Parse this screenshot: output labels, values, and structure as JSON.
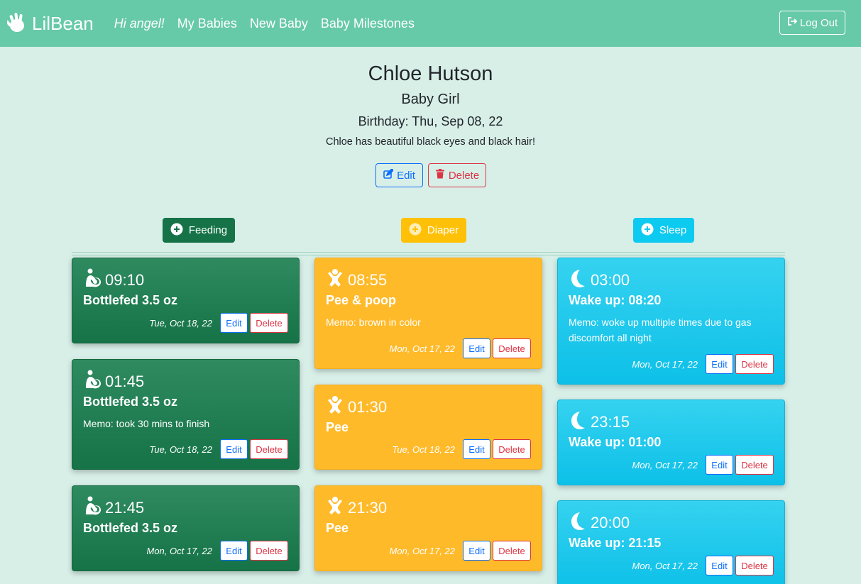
{
  "navbar": {
    "brand": "LilBean",
    "greeting": "Hi angel!",
    "links": [
      "My Babies",
      "New Baby",
      "Baby Milestones"
    ],
    "logout_label": "Log Out"
  },
  "baby": {
    "name": "Chloe Hutson",
    "gender": "Baby Girl",
    "birthday": "Birthday: Thu, Sep 08, 22",
    "description": "Chloe has beautiful black eyes and black hair!",
    "edit_label": "Edit",
    "delete_label": "Delete"
  },
  "add_buttons": {
    "feeding": "Feeding",
    "diaper": "Diaper",
    "sleep": "Sleep"
  },
  "card_buttons": {
    "edit": "Edit",
    "delete": "Delete"
  },
  "feedings": [
    {
      "time": "09:10",
      "title": "Bottlefed 3.5 oz",
      "memo": "",
      "date": "Tue, Oct 18, 22"
    },
    {
      "time": "01:45",
      "title": "Bottlefed 3.5 oz",
      "memo": "Memo: took 30 mins to finish",
      "date": "Tue, Oct 18, 22"
    },
    {
      "time": "21:45",
      "title": "Bottlefed 3.5 oz",
      "memo": "",
      "date": "Mon, Oct 17, 22"
    }
  ],
  "diapers": [
    {
      "time": "08:55",
      "title": "Pee & poop",
      "memo": "Memo: brown in color",
      "date": "Mon, Oct 17, 22"
    },
    {
      "time": "01:30",
      "title": "Pee",
      "memo": "",
      "date": "Tue, Oct 18, 22"
    },
    {
      "time": "21:30",
      "title": "Pee",
      "memo": "",
      "date": "Mon, Oct 17, 22"
    }
  ],
  "sleeps": [
    {
      "time": "03:00",
      "title": "Wake up: 08:20",
      "memo": "Memo: woke up multiple times due to gas discomfort all night",
      "date": "Mon, Oct 17, 22"
    },
    {
      "time": "23:15",
      "title": "Wake up: 01:00",
      "memo": "",
      "date": "Mon, Oct 17, 22"
    },
    {
      "time": "20:00",
      "title": "Wake up: 21:15",
      "memo": "",
      "date": "Mon, Oct 17, 22"
    }
  ],
  "colors": {
    "navbar": "#66c9a8",
    "background": "#d8efe8",
    "feeding": "#157347",
    "diaper": "#ffc107",
    "sleep": "#0dcaf0"
  },
  "icons": {
    "brand": "waving-hand-icon",
    "logout": "sign-out-icon",
    "edit": "pen-to-square-icon",
    "delete": "trash-icon",
    "add": "plus-circle-icon",
    "feeding": "person-breastfeeding-icon",
    "diaper": "baby-icon",
    "sleep": "moon-icon"
  }
}
